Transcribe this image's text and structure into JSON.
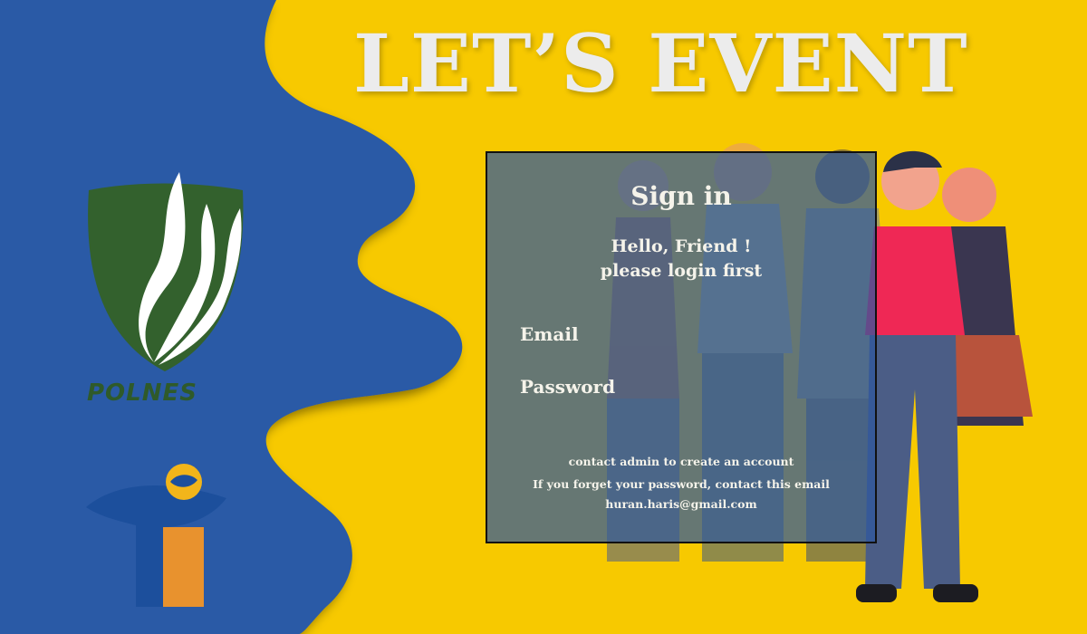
{
  "header": {
    "title": "LET’S EVENT"
  },
  "logos": {
    "polnes_text": "POLNES"
  },
  "signin": {
    "title": "Sign in",
    "greeting_line1": "Hello, Friend !",
    "greeting_line2": "please login first",
    "email_label": "Email",
    "email_value": "",
    "password_label": "Password",
    "password_value": "",
    "note_admin": "contact admin to create an account",
    "note_forgot": "If you forget your password, contact this email",
    "note_email": "huran.haris@gmail.com"
  },
  "colors": {
    "blue_paper": "#2b5aa6",
    "yellow_paper": "#f7c900",
    "card_overlay": "#2e58a0",
    "title_text": "#ececec",
    "polnes_green": "#2f5a2a",
    "ti_blue": "#1c4f9c",
    "ti_orange": "#e8922e"
  },
  "icons": {
    "polnes_logo": "polnes-shield-logo-icon",
    "ti_logo": "ti-logo-icon",
    "people_illustration": "people-group-illustration"
  }
}
